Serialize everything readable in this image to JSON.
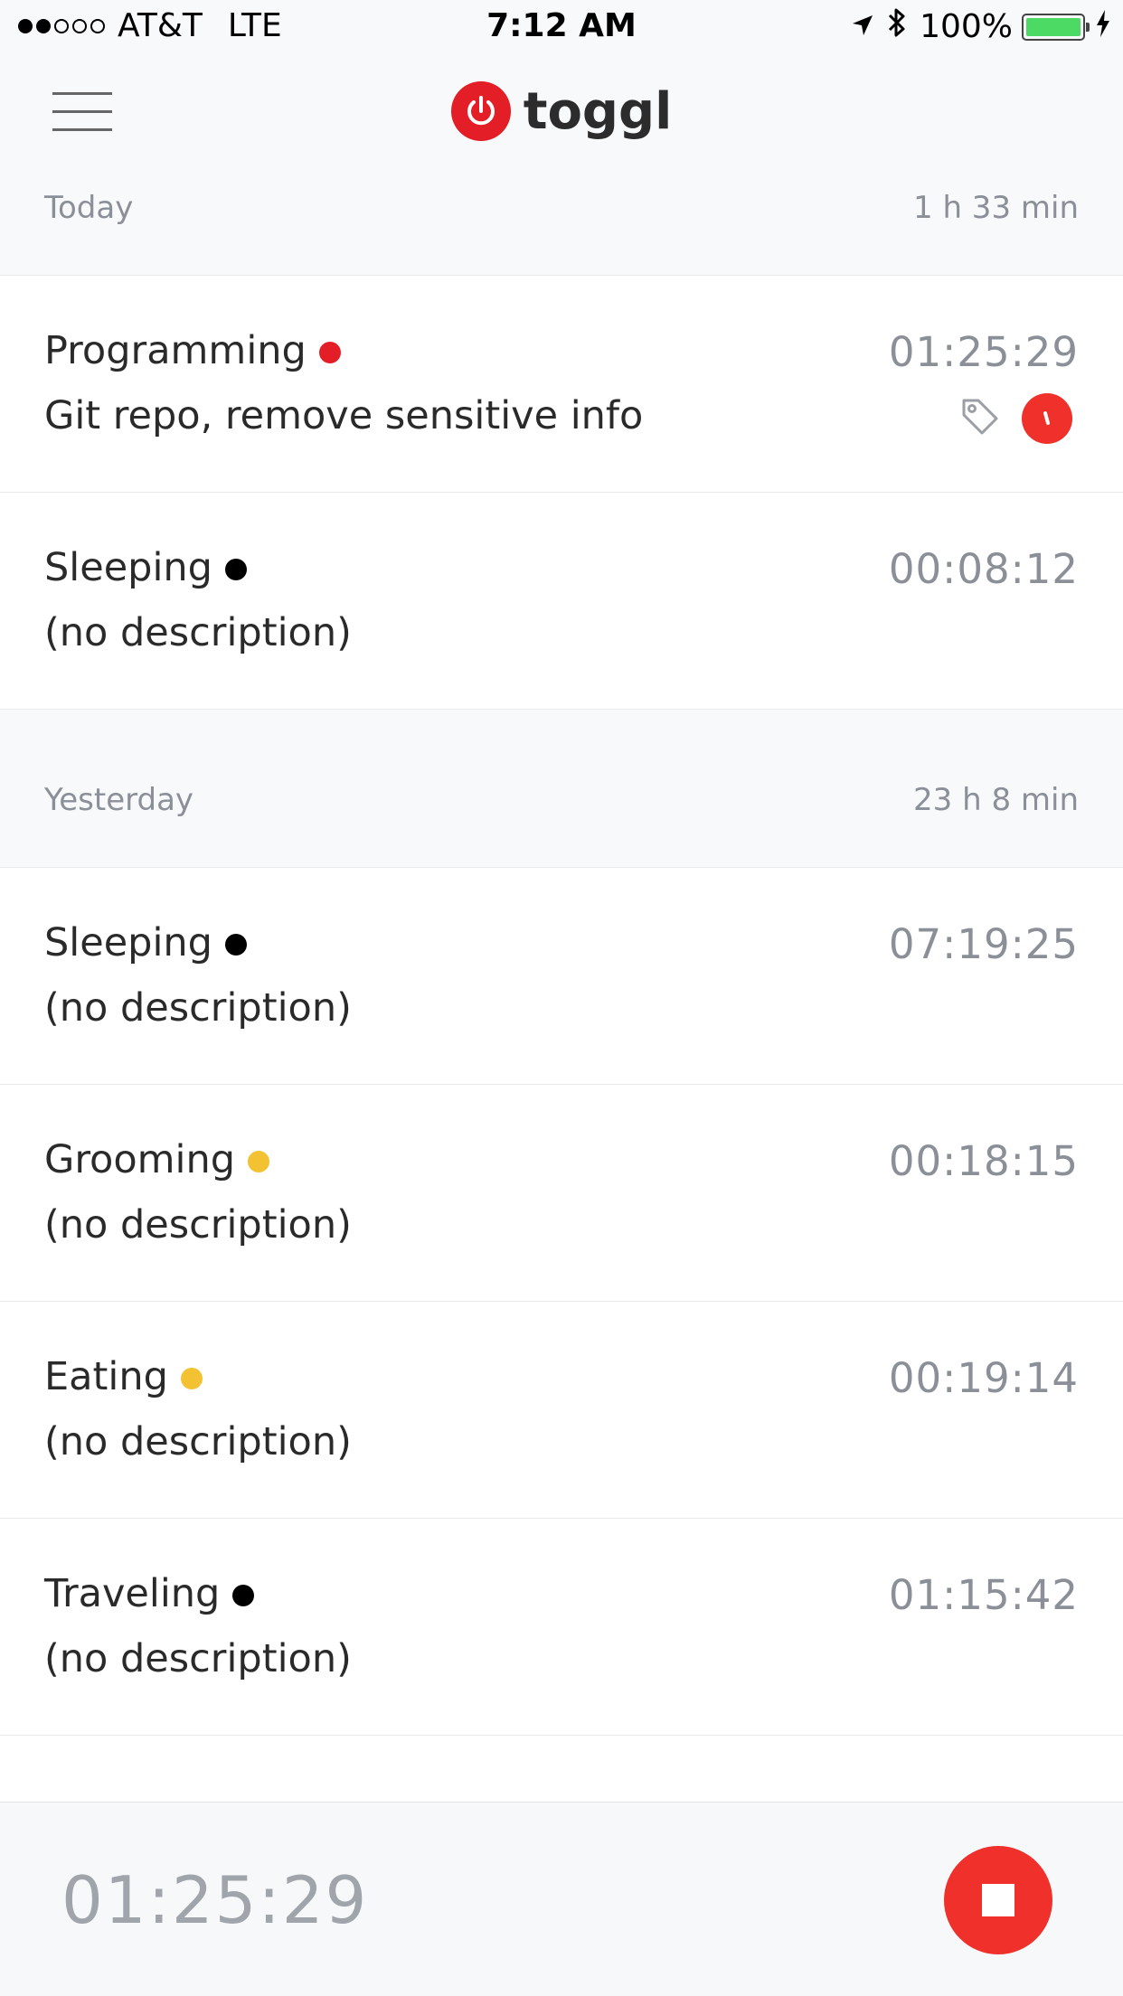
{
  "status_bar": {
    "carrier": "AT&T",
    "network": "LTE",
    "time": "7:12 AM",
    "battery_text": "100%",
    "battery_level": 1.0,
    "battery_color": "#4cd964"
  },
  "header": {
    "logo_text": "toggl",
    "brand_color": "#e31e27"
  },
  "sections": [
    {
      "title": "Today",
      "total": "1 h 33 min",
      "entries": [
        {
          "project": "Programming",
          "dot_color": "#e31e27",
          "description": "Git repo, remove sensitive info",
          "duration": "01:25:29",
          "has_tag": true,
          "billable": true
        },
        {
          "project": "Sleeping",
          "dot_color": "#000000",
          "description": "(no description)",
          "duration": "00:08:12"
        }
      ]
    },
    {
      "title": "Yesterday",
      "total": "23 h 8 min",
      "entries": [
        {
          "project": "Sleeping",
          "dot_color": "#000000",
          "description": "(no description)",
          "duration": "07:19:25"
        },
        {
          "project": "Grooming",
          "dot_color": "#f2c232",
          "description": "(no description)",
          "duration": "00:18:15"
        },
        {
          "project": "Eating",
          "dot_color": "#f2c232",
          "description": "(no description)",
          "duration": "00:19:14"
        },
        {
          "project": "Traveling",
          "dot_color": "#000000",
          "description": "(no description)",
          "duration": "01:15:42"
        }
      ]
    }
  ],
  "timer": {
    "running_duration": "01:25:29"
  }
}
